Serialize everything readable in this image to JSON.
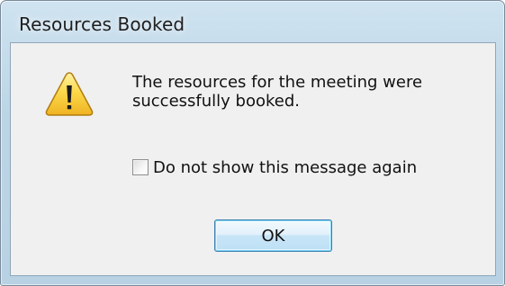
{
  "window": {
    "title": "Resources Booked"
  },
  "dialog": {
    "icon": "warning-icon",
    "message": "The resources for the meeting were successfully booked.",
    "checkbox": {
      "label": "Do not show this message again",
      "checked": false
    },
    "ok_label": "OK"
  },
  "colors": {
    "frame": "#bcd5e6",
    "client": "#f0f0f0",
    "warning_yellow": "#f7c531",
    "button_border": "#3c7fb1"
  }
}
